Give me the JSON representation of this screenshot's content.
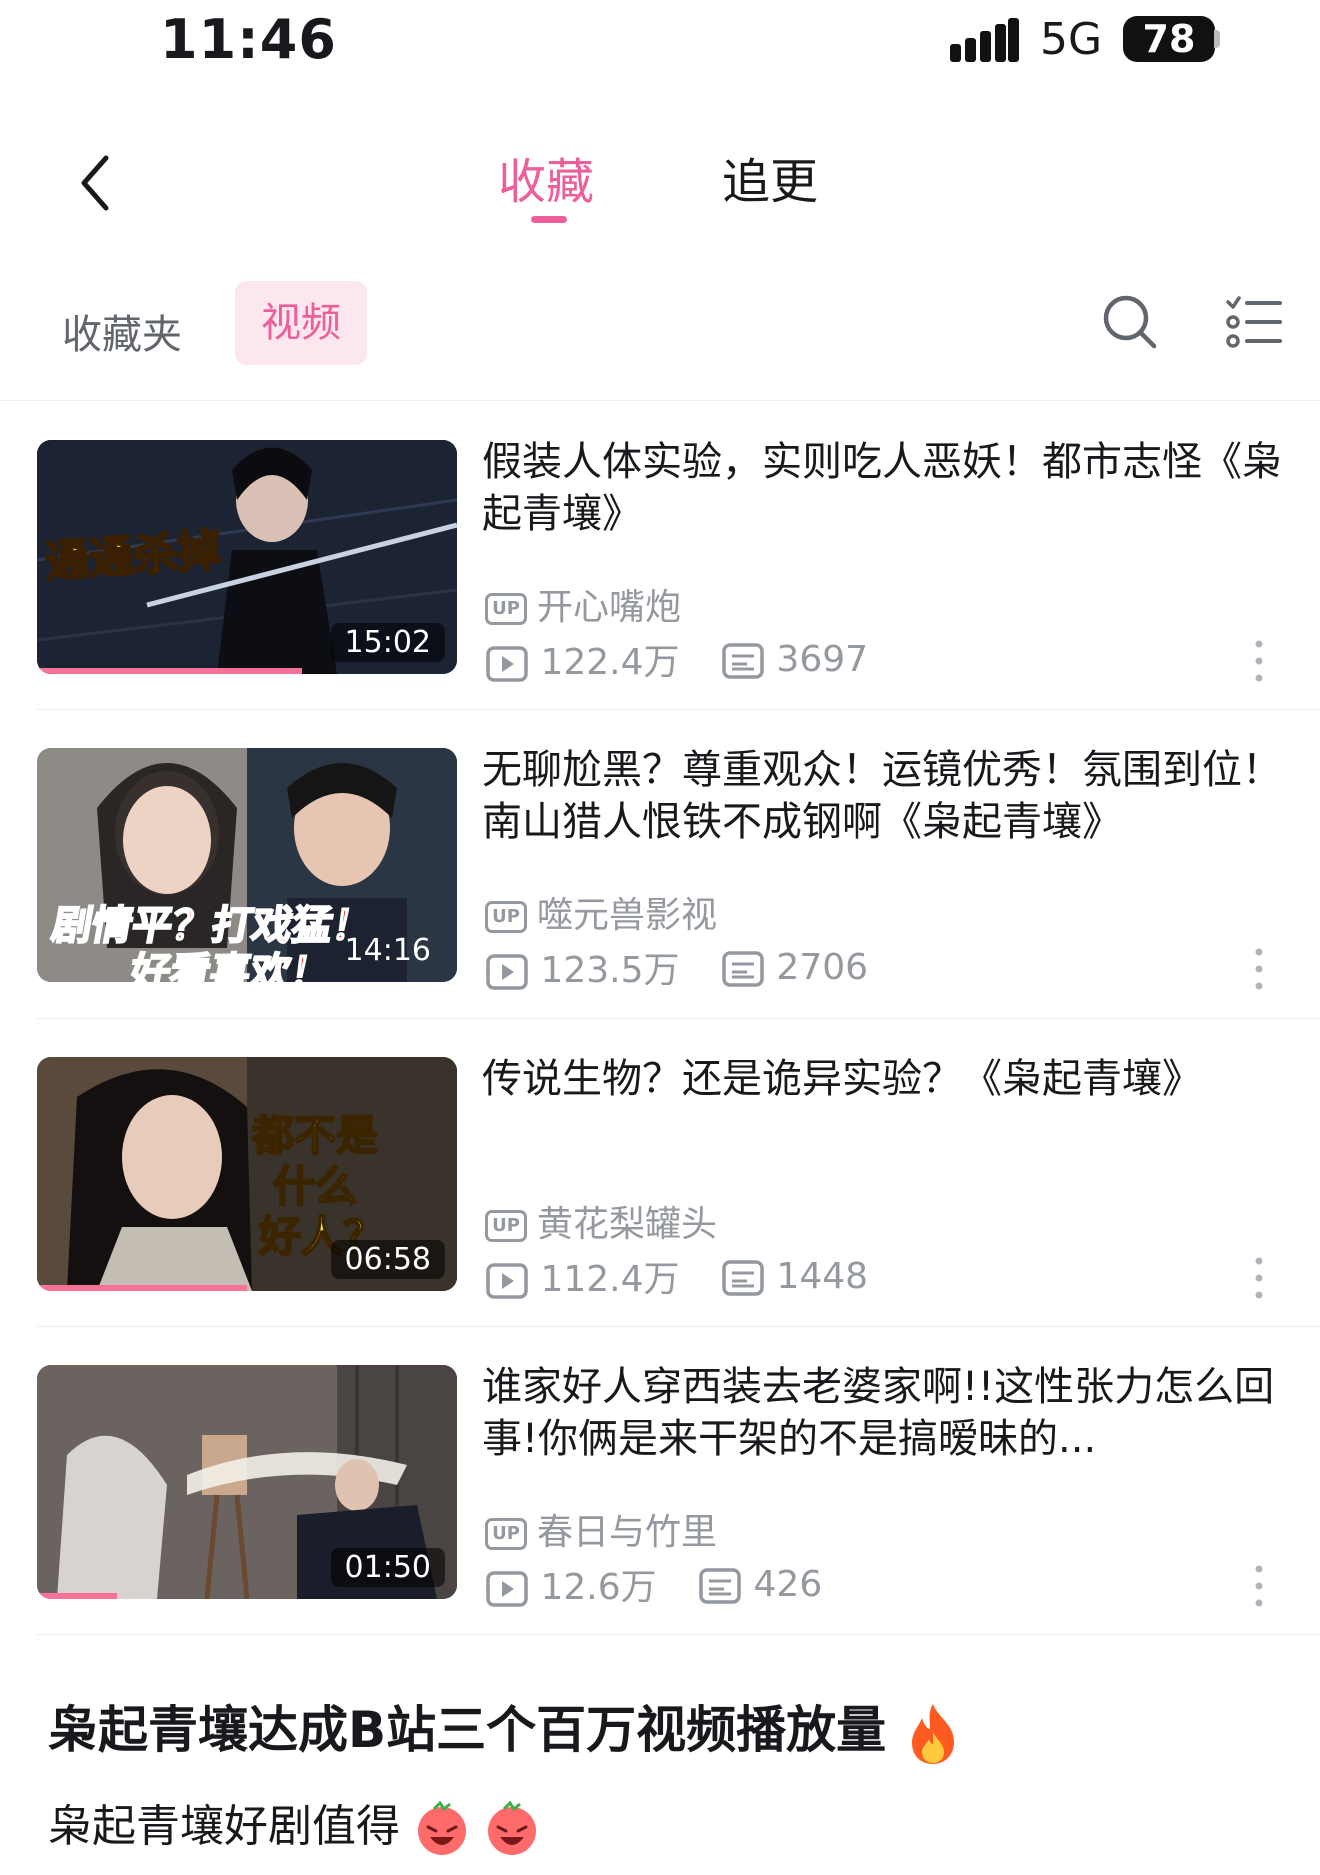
{
  "status_bar": {
    "time": "11:46",
    "network": "5G",
    "battery": "78"
  },
  "header": {
    "tabs": [
      "收藏",
      "追更"
    ],
    "active_tab": "收藏"
  },
  "subtabs": {
    "folder": "收藏夹",
    "video": "视频"
  },
  "videos": [
    {
      "title": "假装人体实验，实则吃人恶妖！都市志怪《枭起青壤》",
      "thumb_text": "通通杀掉",
      "duration": "15:02",
      "uploader": "开心嘴炮",
      "views": "122.4万",
      "comments": "3697",
      "watched": 0.63
    },
    {
      "title": "无聊尬黑？尊重观众！运镜优秀！氛围到位！南山猎人恨铁不成钢啊《枭起青壤》",
      "thumb_text": "剧情平？打戏猛！",
      "thumb_text2": "好看喜欢！",
      "duration": "14:16",
      "uploader": "噬元兽影视",
      "views": "123.5万",
      "comments": "2706",
      "watched": 0
    },
    {
      "title": "传说生物？还是诡异实验？《枭起青壤》",
      "thumb_text": "都不是",
      "thumb_text2": "什么",
      "thumb_text3": "好人？",
      "duration": "06:58",
      "uploader": "黄花梨罐头",
      "views": "112.4万",
      "comments": "1448",
      "watched": 0.5
    },
    {
      "title": "谁家好人穿西装去老婆家啊!!这性张力怎么回事!你俩是来干架的不是搞暧昧的...",
      "duration": "01:50",
      "uploader": "春日与竹里",
      "views": "12.6万",
      "comments": "426",
      "watched": 0.19
    }
  ],
  "caption": "枭起青壤达成B站三个百万视频播放量",
  "subcaption": "枭起青壤好剧值得",
  "colors": {
    "accent": "#ec5f9b",
    "progress": "#fb7299",
    "meta": "#9499a0"
  },
  "icons": [
    "back-icon",
    "search-icon",
    "sort-list-icon",
    "up-badge-icon",
    "play-count-icon",
    "danmaku-icon",
    "more-vertical-icon",
    "fire-icon",
    "laughing-emoji-icon"
  ]
}
